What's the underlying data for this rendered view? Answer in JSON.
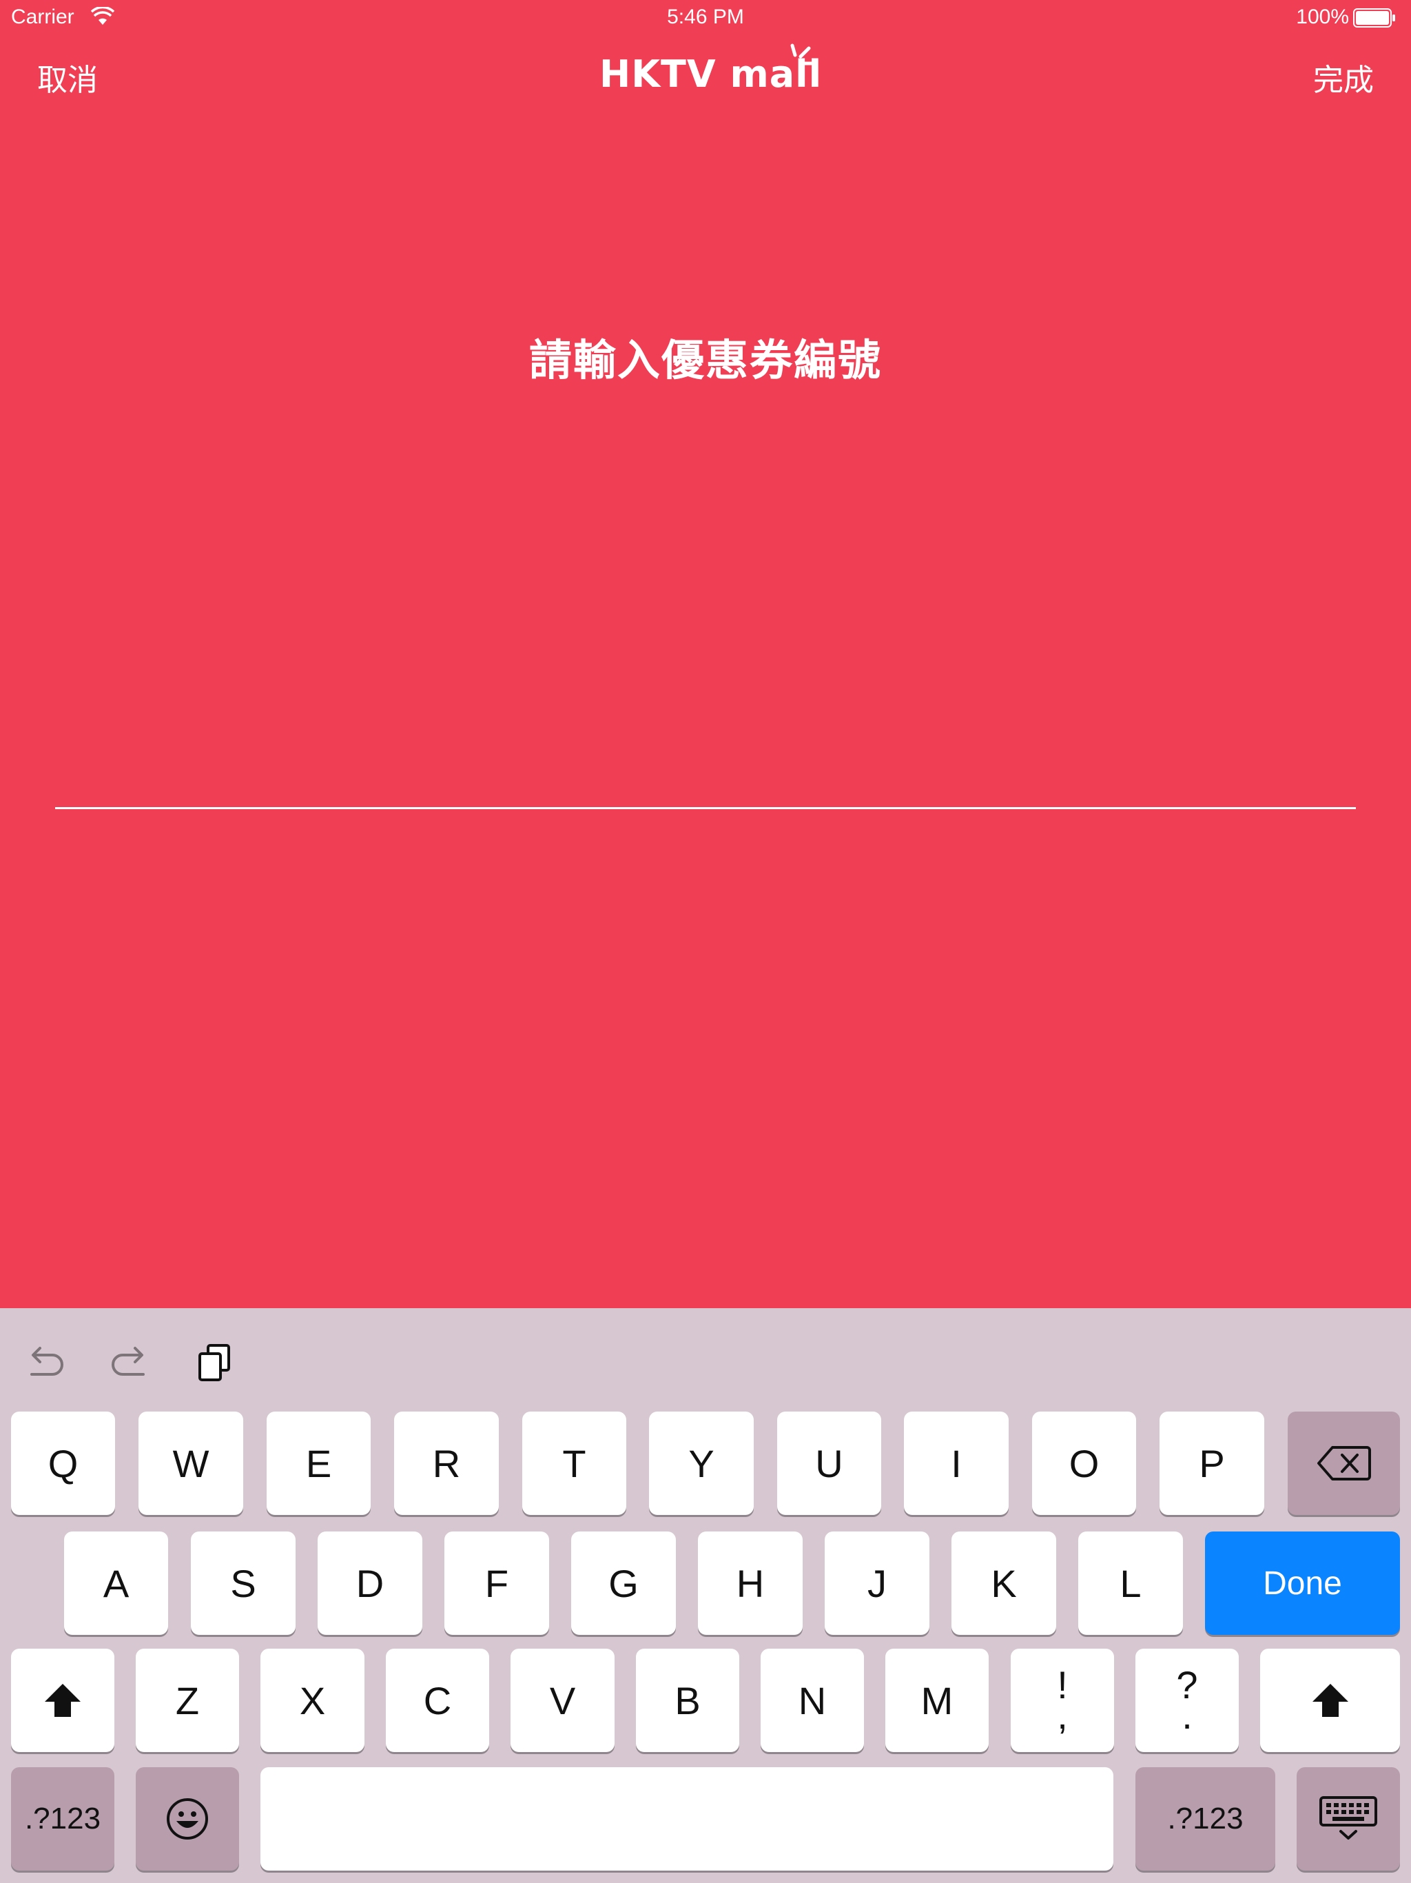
{
  "status_bar": {
    "carrier": "Carrier",
    "time": "5:46 PM",
    "battery": "100%"
  },
  "nav": {
    "cancel_label": "取消",
    "logo_text": "HKTV mall",
    "done_label": "完成"
  },
  "main": {
    "prompt": "請輸入優惠券編號",
    "coupon_value": ""
  },
  "keyboard": {
    "row1": [
      "Q",
      "W",
      "E",
      "R",
      "T",
      "Y",
      "U",
      "I",
      "O",
      "P"
    ],
    "row2": [
      "A",
      "S",
      "D",
      "F",
      "G",
      "H",
      "J",
      "K",
      "L"
    ],
    "row3": [
      "Z",
      "X",
      "C",
      "V",
      "B",
      "N",
      "M"
    ],
    "punct1": [
      "!",
      ","
    ],
    "punct2": [
      "?",
      "."
    ],
    "done_label": "Done",
    "numbers_label": ".?123",
    "icons": [
      "undo-icon",
      "redo-icon",
      "paste-icon",
      "delete-icon",
      "shift-icon",
      "emoji-icon",
      "dismiss-keyboard-icon"
    ]
  },
  "colors": {
    "background": "#f03e55",
    "keyboard_bg": "#d7c7d1",
    "func_key": "#b89ead",
    "done_key": "#0a84ff"
  }
}
